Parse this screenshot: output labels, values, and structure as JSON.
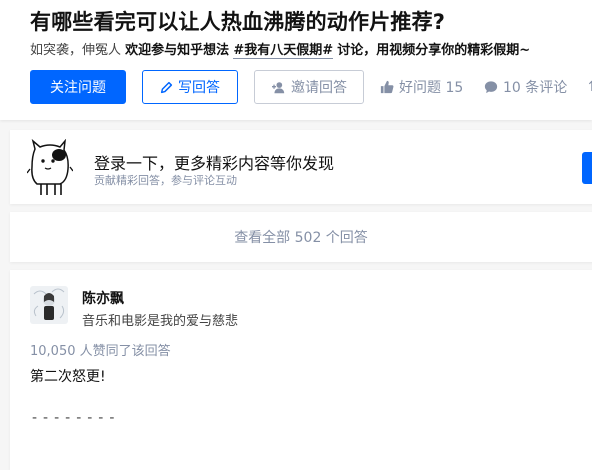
{
  "question": {
    "title": "有哪些看完可以让人热血沸腾的动作片推荐?",
    "detail_prefix": "如突袭，伸冤人",
    "detail_invite": "欢迎参与知乎想法",
    "detail_tag": "#我有八天假期#",
    "detail_suffix": "讨论，用视频分享你的精彩假期~"
  },
  "actions": {
    "follow_label": "关注问题",
    "write_label": "写回答",
    "invite_label": "邀请回答",
    "good_question_label": "好问题 15",
    "comments_label": "10 条评论",
    "more_label": "↑",
    "colors": {
      "primary": "#0066ff",
      "muted": "#8590a6"
    },
    "icons": [
      "pencil-icon",
      "invite-user-icon",
      "thumbs-up-icon",
      "comment-bubble-icon"
    ]
  },
  "login_banner": {
    "title": "登录一下，更多精彩内容等你发现",
    "subtitle": "贡献精彩回答，参与评论互动"
  },
  "view_all": {
    "label": "查看全部 502 个回答"
  },
  "answer": {
    "author_name": "陈亦飘",
    "author_bio": "音乐和电影是我的爱与慈悲",
    "vote_info": "10,050 人赞同了该回答",
    "text": "第二次怒更!",
    "divider": "--------"
  }
}
